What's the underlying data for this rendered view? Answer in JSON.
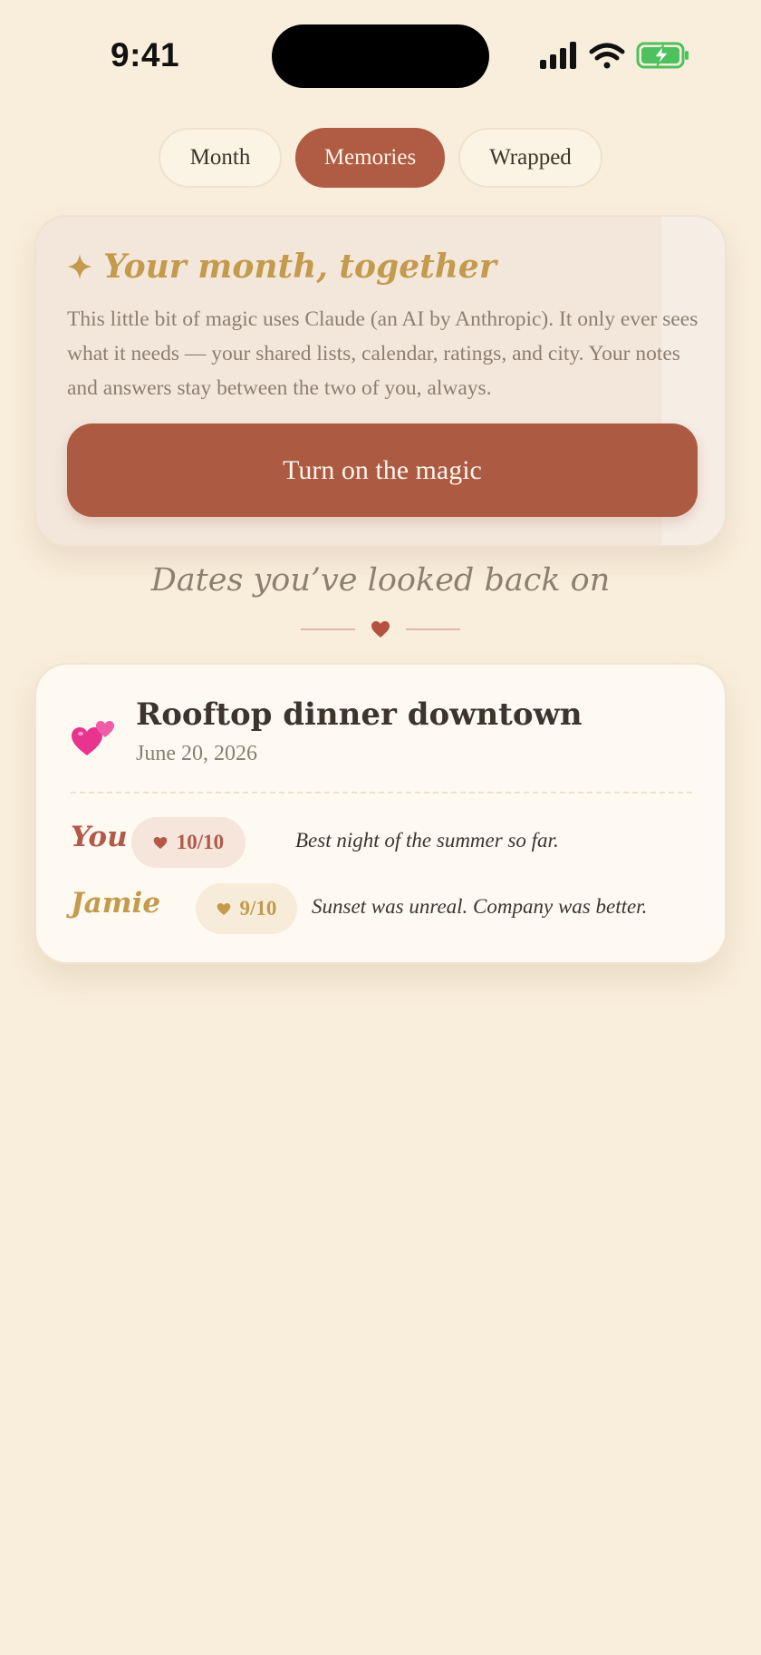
{
  "status_bar": {
    "time": "9:41",
    "icons": [
      "signal-icon",
      "wifi-icon",
      "battery-charging-icon"
    ],
    "battery_color": "#4cc15e"
  },
  "tabs": [
    {
      "label": "Month",
      "active": false
    },
    {
      "label": "Memories",
      "active": true
    },
    {
      "label": "Wrapped",
      "active": false
    }
  ],
  "magic_card": {
    "icon": "sparkle-icon",
    "title": "Your month, together",
    "body": "This little bit of magic uses Claude (an AI by Anthropic). It only ever sees what it needs — your shared lists, calendar, ratings, and city. Your notes and answers stay between the two of you, always.",
    "button_label": "Turn on the magic"
  },
  "section": {
    "title": "Dates you’ve looked back on",
    "divider_icon": "heart-icon"
  },
  "memory": {
    "emoji_icon": "two-hearts-icon",
    "title": "Rooftop dinner downtown",
    "date": "June 20, 2026",
    "ratings": [
      {
        "name": "You",
        "score": "10/10",
        "note": "Best night of the summer so far."
      },
      {
        "name": "Jamie",
        "score": "9/10",
        "note": "Sunset was unreal. Company was better."
      }
    ]
  },
  "colors": {
    "background": "#f9eedb",
    "accent": "#b05b44",
    "gold": "#c49a4c",
    "text": "#3d352c",
    "muted": "#8e8070"
  }
}
